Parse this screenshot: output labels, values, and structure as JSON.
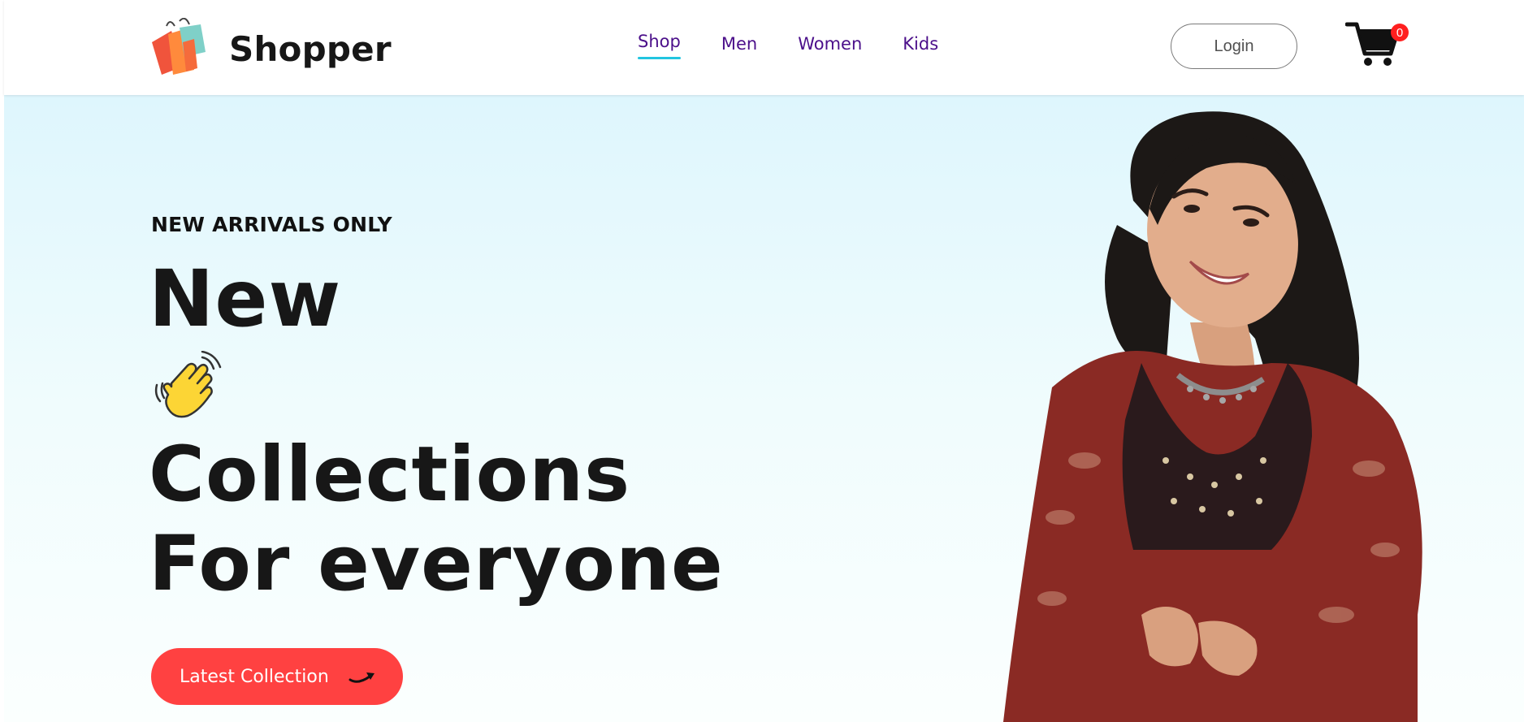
{
  "brand": {
    "name": "Shopper",
    "logo_icon": "shopping-bags-icon"
  },
  "nav": {
    "items": [
      {
        "label": "Shop",
        "active": true
      },
      {
        "label": "Men",
        "active": false
      },
      {
        "label": "Women",
        "active": false
      },
      {
        "label": "Kids",
        "active": false
      }
    ],
    "login_label": "Login",
    "cart_icon": "cart-icon",
    "cart_count": "0"
  },
  "hero": {
    "eyebrow": "NEW ARRIVALS ONLY",
    "headline": {
      "line1": "New",
      "line2": "Collections",
      "line3": "For everyone"
    },
    "hand_icon": "waving-hand-icon",
    "cta_label": "Latest Collection",
    "cta_icon": "arrow-icon",
    "image": "hero-model-image"
  },
  "colors": {
    "accent": "#ff4141",
    "nav_text": "#4b0f8a",
    "nav_active_underline": "#22c5e0",
    "badge": "#ff1f1f",
    "hero_bg_top": "#def6fd",
    "hero_bg_bottom": "#fbfffe"
  }
}
